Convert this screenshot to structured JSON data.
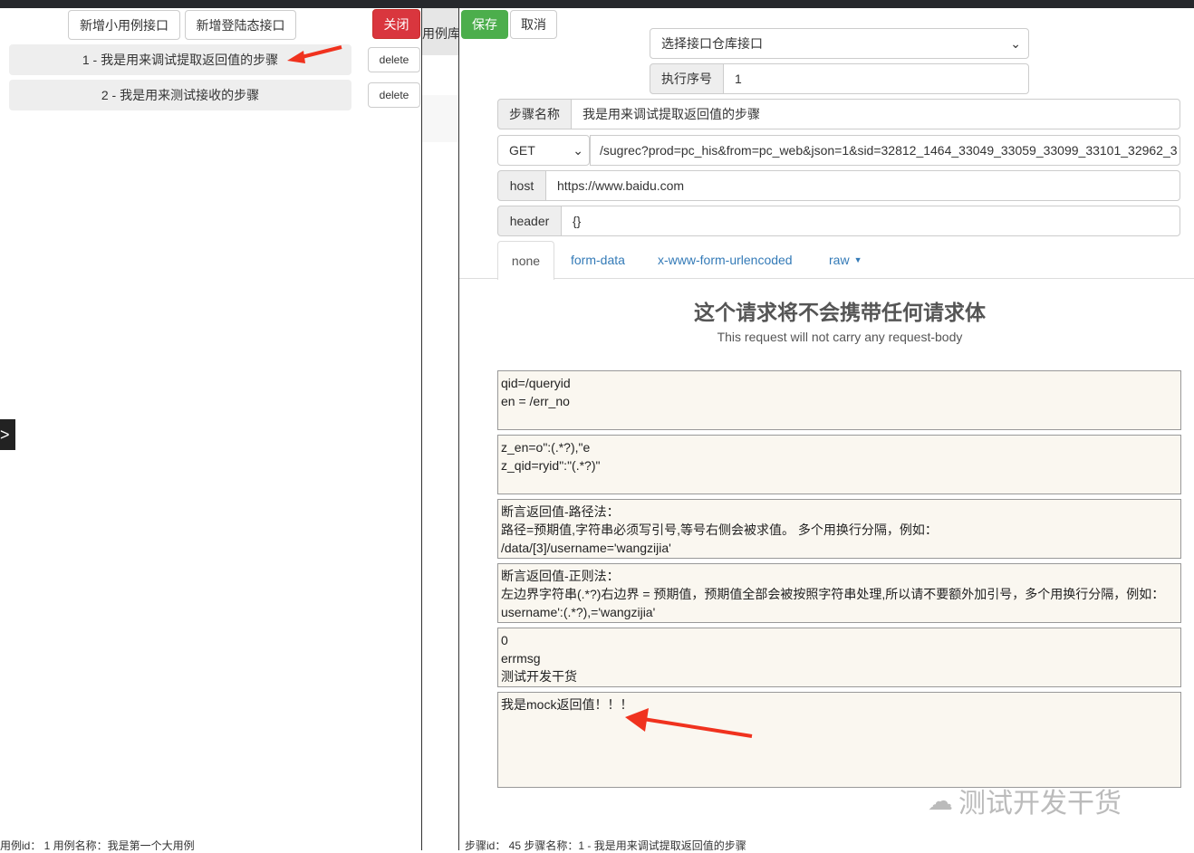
{
  "left": {
    "add_case_btn": "新增小用例接口",
    "add_login_btn": "新增登陆态接口",
    "close_btn": "关闭",
    "steps": [
      {
        "label": "1 - 我是用来调试提取返回值的步骤",
        "delete": "delete"
      },
      {
        "label": "2 - 我是用来测试接收的步骤",
        "delete": "delete"
      }
    ],
    "expand": ">",
    "footer": "用例id： 1 用例名称：我是第一个大用例"
  },
  "middle": {
    "tab": "用例库"
  },
  "right": {
    "save": "保存",
    "cancel": "取消",
    "repo_select": "选择接口仓库接口",
    "order_label": "执行序号",
    "order_value": "1",
    "name_label": "步骤名称",
    "name_value": "我是用来调试提取返回值的步骤",
    "method": "GET",
    "url": "/sugrec?prod=pc_his&from=pc_web&json=1&sid=32812_1464_33049_33059_33099_33101_32962_3",
    "host_label": "host",
    "host_value": "https://www.baidu.com",
    "header_label": "header",
    "header_value": "{}",
    "tabs": [
      "none",
      "form-data",
      "x-www-form-urlencoded",
      "raw"
    ],
    "no_body_title": "这个请求将不会携带任何请求体",
    "no_body_sub": "This request will not carry any request-body",
    "textareas": [
      "qid=/queryid\nen = /err_no",
      "z_en=o\":(.*?),\"e\nz_qid=ryid\":\"(.*?)\"",
      "断言返回值-路径法：\n路径=预期值,字符串必须写引号,等号右侧会被求值。 多个用换行分隔，例如：\n/data/[3]/username='wangzijia'",
      "断言返回值-正则法：\n左边界字符串(.*?)右边界 = 预期值，预期值全部会被按照字符串处理,所以请不要额外加引号，多个用换行分隔，例如：\nusername':(.*?),='wangzijia'",
      "0\nerrmsg\n测试开发干货",
      "我是mock返回值！！！"
    ],
    "footer": "步骤id： 45 步骤名称：1 - 我是用来调试提取返回值的步骤",
    "watermark": "测试开发干货"
  },
  "colors": {
    "close": "#d9363e",
    "save": "#4cae4c",
    "link": "#337ab7",
    "arrow": "#f0321e"
  }
}
